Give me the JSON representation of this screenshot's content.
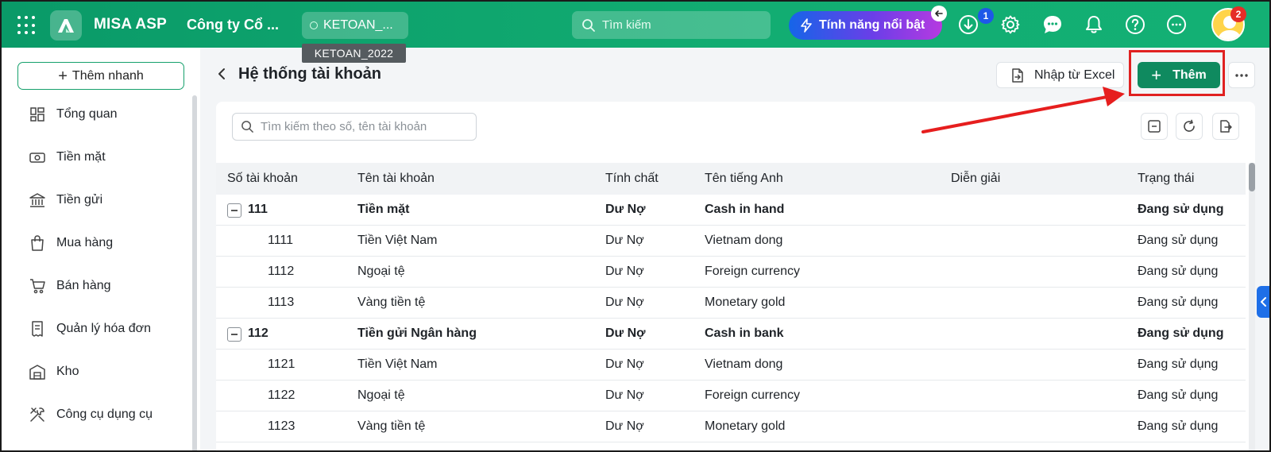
{
  "app": {
    "name": "MISA ASP",
    "company": "Công ty Cổ ...",
    "database": "KETOAN_...",
    "database_tooltip": "KETOAN_2022"
  },
  "topbar": {
    "search_placeholder": "Tìm kiếm",
    "feature_label": "Tính năng nổi bật",
    "download_badge": "1",
    "avatar_badge": "2",
    "icons": [
      "grid-icon",
      "download-icon",
      "gear-icon",
      "chat-icon",
      "bell-icon",
      "help-icon",
      "more-icon"
    ],
    "colors": {
      "topbar": "#12ad72",
      "primary": "#0f8a5f",
      "badge_blue": "#1e58e8",
      "badge_red": "#e52d27"
    }
  },
  "sidebar": {
    "quick_add": "Thêm nhanh",
    "items": [
      {
        "label": "Tổng quan",
        "icon": "dashboard-icon"
      },
      {
        "label": "Tiền mặt",
        "icon": "cash-icon"
      },
      {
        "label": "Tiền gửi",
        "icon": "bank-icon"
      },
      {
        "label": "Mua hàng",
        "icon": "shopping-bag-icon"
      },
      {
        "label": "Bán hàng",
        "icon": "cart-icon"
      },
      {
        "label": "Quản lý hóa đơn",
        "icon": "invoice-icon"
      },
      {
        "label": "Kho",
        "icon": "warehouse-icon"
      },
      {
        "label": "Công cụ dụng cụ",
        "icon": "tools-icon"
      }
    ]
  },
  "page": {
    "title": "Hệ thống tài khoản",
    "import_excel": "Nhập từ Excel",
    "add": "Thêm",
    "search_placeholder": "Tìm kiếm theo số, tên tài khoản"
  },
  "table": {
    "headers": [
      "Số tài khoản",
      "Tên tài khoản",
      "Tính chất",
      "Tên tiếng Anh",
      "Diễn giải",
      "Trạng thái"
    ],
    "rows": [
      {
        "code": "111",
        "name": "Tiền mặt",
        "nature": "Dư Nợ",
        "english": "Cash in hand",
        "desc": "",
        "status": "Đang sử dụng",
        "parent": true
      },
      {
        "code": "1111",
        "name": "Tiền Việt Nam",
        "nature": "Dư Nợ",
        "english": "Vietnam dong",
        "desc": "",
        "status": "Đang sử dụng",
        "parent": false
      },
      {
        "code": "1112",
        "name": "Ngoại tệ",
        "nature": "Dư Nợ",
        "english": "Foreign currency",
        "desc": "",
        "status": "Đang sử dụng",
        "parent": false
      },
      {
        "code": "1113",
        "name": "Vàng tiền tệ",
        "nature": "Dư Nợ",
        "english": "Monetary gold",
        "desc": "",
        "status": "Đang sử dụng",
        "parent": false
      },
      {
        "code": "112",
        "name": "Tiền gửi Ngân hàng",
        "nature": "Dư Nợ",
        "english": "Cash in bank",
        "desc": "",
        "status": "Đang sử dụng",
        "parent": true
      },
      {
        "code": "1121",
        "name": "Tiền Việt Nam",
        "nature": "Dư Nợ",
        "english": "Vietnam dong",
        "desc": "",
        "status": "Đang sử dụng",
        "parent": false
      },
      {
        "code": "1122",
        "name": "Ngoại tệ",
        "nature": "Dư Nợ",
        "english": "Foreign currency",
        "desc": "",
        "status": "Đang sử dụng",
        "parent": false
      },
      {
        "code": "1123",
        "name": "Vàng tiền tệ",
        "nature": "Dư Nợ",
        "english": "Monetary gold",
        "desc": "",
        "status": "Đang sử dụng",
        "parent": false
      }
    ]
  }
}
